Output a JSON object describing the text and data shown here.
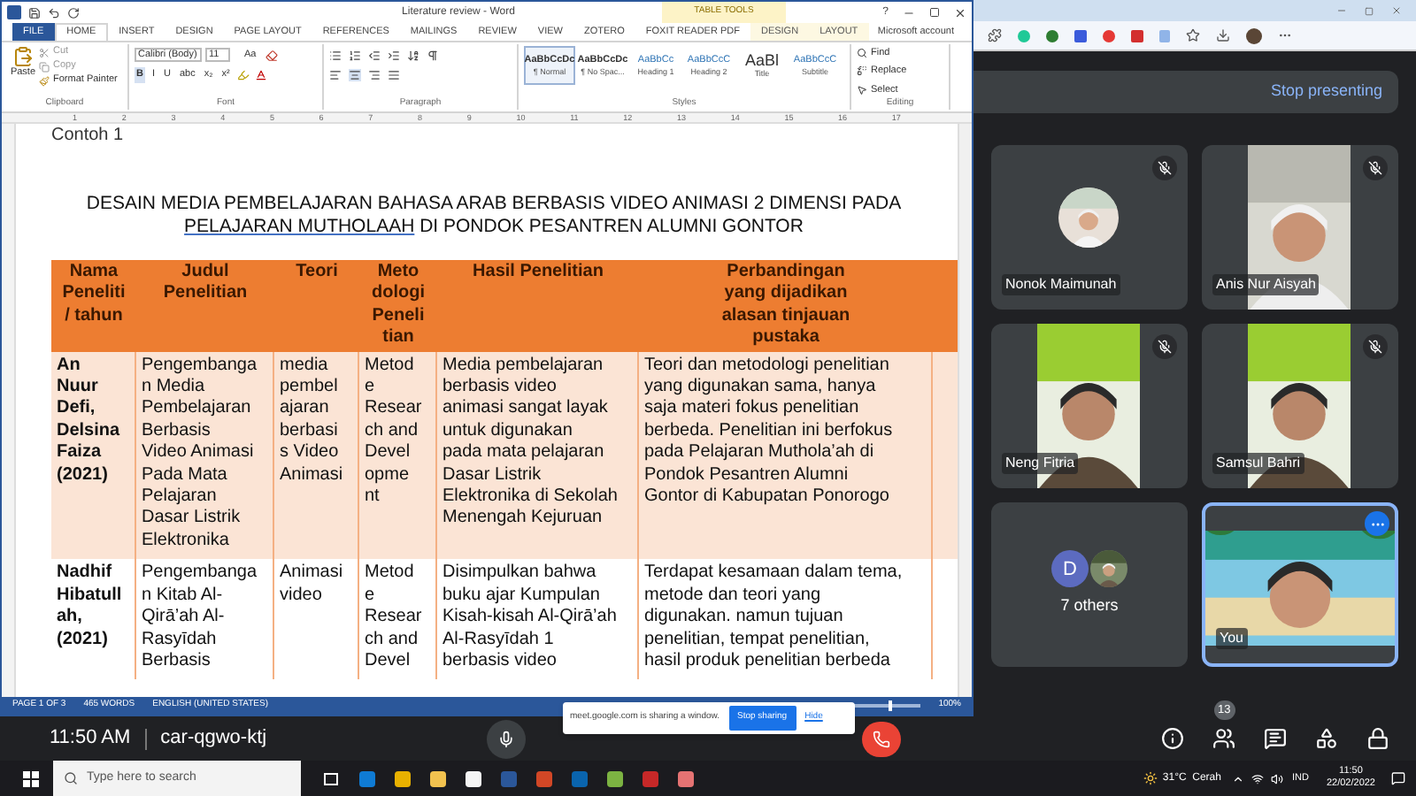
{
  "word": {
    "title": "Literature review - Word",
    "help": "?",
    "context_group": "TABLE TOOLS",
    "account": "Microsoft account",
    "tabs": [
      {
        "label": "FILE",
        "kind": "file",
        "selected": false
      },
      {
        "label": "HOME",
        "kind": "tab",
        "selected": true
      },
      {
        "label": "INSERT",
        "kind": "tab",
        "selected": false
      },
      {
        "label": "DESIGN",
        "kind": "tab",
        "selected": false
      },
      {
        "label": "PAGE LAYOUT",
        "kind": "tab",
        "selected": false
      },
      {
        "label": "REFERENCES",
        "kind": "tab",
        "selected": false
      },
      {
        "label": "MAILINGS",
        "kind": "tab",
        "selected": false
      },
      {
        "label": "REVIEW",
        "kind": "tab",
        "selected": false
      },
      {
        "label": "VIEW",
        "kind": "tab",
        "selected": false
      },
      {
        "label": "ZOTERO",
        "kind": "tab",
        "selected": false
      },
      {
        "label": "FOXIT READER PDF",
        "kind": "tab",
        "selected": false
      },
      {
        "label": "DESIGN",
        "kind": "context",
        "selected": false
      },
      {
        "label": "LAYOUT",
        "kind": "context",
        "selected": false
      }
    ],
    "clipboard": {
      "paste": "Paste",
      "cut": "Cut",
      "copy": "Copy",
      "format_painter": "Format Painter",
      "label": "Clipboard"
    },
    "font": {
      "name": "Calibri (Body)",
      "size": "11",
      "case": "Aa",
      "buttons": [
        "B",
        "I",
        "U",
        "abc",
        "x₂",
        "x²"
      ],
      "label": "Font"
    },
    "paragraph": {
      "label": "Paragraph"
    },
    "styles": {
      "label": "Styles",
      "items": [
        {
          "preview": "AaBbCcDc",
          "name": "¶ Normal",
          "selected": true
        },
        {
          "preview": "AaBbCcDc",
          "name": "¶ No Spac...",
          "selected": false
        },
        {
          "preview": "AaBbCc",
          "name": "Heading 1",
          "selected": false
        },
        {
          "preview": "AaBbCcC",
          "name": "Heading 2",
          "selected": false
        },
        {
          "preview": "AaBl",
          "name": "Title",
          "selected": false
        },
        {
          "preview": "AaBbCcC",
          "name": "Subtitle",
          "selected": false
        }
      ]
    },
    "editing": {
      "find": "Find",
      "replace": "Replace",
      "select": "Select",
      "label": "Editing"
    },
    "ruler": [
      "1",
      "2",
      "3",
      "4",
      "5",
      "6",
      "7",
      "8",
      "9",
      "10",
      "11",
      "12",
      "13",
      "14",
      "15",
      "16",
      "17"
    ],
    "document": {
      "heading": "Contoh 1",
      "title_line_1": "DESAIN MEDIA PEMBELAJARAN BAHASA ARAB BERBASIS VIDEO ANIMASI 2 DIMENSI PADA",
      "title_line_2": [
        {
          "text": "PELAJARAN  MUTHOLAAH",
          "underlined": true
        },
        {
          "text": " DI PONDOK PESANTREN ALUMNI GONTOR",
          "underlined": false
        }
      ],
      "table": {
        "columns": [
          "Nama\nPeneliti\n/ tahun",
          "Judul\nPenelitian",
          "Teori",
          "Meto\ndologi\nPeneli\ntian",
          "Hasil Penelitian",
          "Perbandingan\nyang dijadikan\nalasan tinjauan\npustaka"
        ],
        "rows": [
          {
            "shaded": true,
            "cells": [
              "An\nNuur\nDefi,\nDelsina\nFaiza\n(2021)",
              "Pengembanga\nn Media\nPembelajaran\nBerbasis\nVideo Animasi\nPada Mata\nPelajaran\nDasar Listrik\nElektronika",
              "media\npembel\najaran\nberbasi\ns Video\nAnimasi",
              "Metod\ne\nResear\nch and\nDevel\nopme\nnt",
              "Media pembelajaran\nberbasis video\nanimasi sangat layak\nuntuk digunakan\npada mata pelajaran\nDasar Listrik\nElektronika di Sekolah\nMenengah Kejuruan",
              "Teori dan metodologi penelitian\nyang digunakan sama, hanya\nsaja materi fokus penelitian\nberbeda. Penelitian ini berfokus\npada Pelajaran Muthola’ah di\nPondok Pesantren Alumni\nGontor di Kabupatan Ponorogo"
            ]
          },
          {
            "shaded": false,
            "cells": [
              "Nadhif\nHibatull\nah,\n(2021)",
              "Pengembanga\nn Kitab Al-\nQirā’ah Al-\nRasyīdah\nBerbasis",
              "Animasi\nvideo",
              "Metod\ne\nResear\nch and\nDevel",
              "Disimpulkan bahwa\nbuku ajar Kumpulan\nKisah-kisah Al-Qirā’ah\nAl-Rasyīdah 1\nberbasis video",
              "Terdapat kesamaan dalam tema,\nmetode dan teori yang\ndigunakan. namun tujuan\npenelitian, tempat penelitian,\nhasil produk penelitian berbeda"
            ]
          }
        ]
      }
    },
    "status": {
      "page": "PAGE 1 OF 3",
      "words": "465 WORDS",
      "language": "ENGLISH (UNITED STATES)",
      "zoom": {
        "level": 0.55,
        "reading": "100%"
      }
    }
  },
  "meet": {
    "stop_presenting": "Stop presenting",
    "tiles": [
      {
        "name": "Nonok Maimunah",
        "kind": "avatar",
        "muted": true
      },
      {
        "name": "Anis Nur Aisyah",
        "kind": "video",
        "muted": true
      },
      {
        "name": "Neng Fitria",
        "kind": "video",
        "muted": true
      },
      {
        "name": "Samsul Bahri",
        "kind": "video",
        "muted": true
      },
      {
        "name": "7 others",
        "kind": "group",
        "initial": "D",
        "muted": false
      },
      {
        "name": "You",
        "kind": "self",
        "muted": false
      }
    ],
    "time": "11:50 AM",
    "code": "car-qgwo-ktj",
    "people_count": "13",
    "share_notice": {
      "text": "meet.google.com is sharing a window.",
      "stop": "Stop sharing",
      "hide": "Hide"
    }
  },
  "taskbar": {
    "search": {
      "placeholder": "Type here to search"
    },
    "weather": "31°C  Cerah",
    "language": "IND",
    "time": "11:50",
    "date": "22/02/2022"
  }
}
